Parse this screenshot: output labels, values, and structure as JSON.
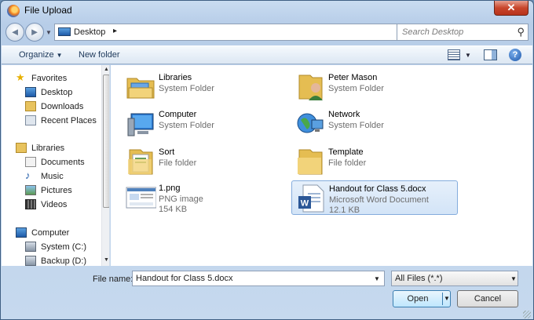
{
  "window": {
    "title": "File Upload",
    "close": "✕"
  },
  "nav": {
    "back": "◄",
    "forward": "►",
    "address": "Desktop",
    "address_chevron": "▸",
    "search_placeholder": "Search Desktop"
  },
  "toolbar": {
    "organize": "Organize",
    "new_folder": "New folder"
  },
  "sidebar": {
    "favorites": "Favorites",
    "desktop": "Desktop",
    "downloads": "Downloads",
    "recent_places": "Recent Places",
    "libraries": "Libraries",
    "documents": "Documents",
    "music": "Music",
    "pictures": "Pictures",
    "videos": "Videos",
    "computer": "Computer",
    "system_c": "System (C:)",
    "backup_d": "Backup (D:)"
  },
  "items": [
    {
      "name": "Libraries",
      "type": "System Folder",
      "icon": "libraries-icon"
    },
    {
      "name": "Peter Mason",
      "type": "System Folder",
      "icon": "user-folder-icon"
    },
    {
      "name": "Computer",
      "type": "System Folder",
      "icon": "computer-icon"
    },
    {
      "name": "Network",
      "type": "System Folder",
      "icon": "network-icon"
    },
    {
      "name": "Sort",
      "type": "File folder",
      "icon": "folder-icon"
    },
    {
      "name": "Template",
      "type": "File folder",
      "icon": "folder-icon"
    },
    {
      "name": "1.png",
      "type": "PNG image",
      "size": "154 KB",
      "icon": "png-thumbnail-icon"
    },
    {
      "name": "Handout for Class 5.docx",
      "type": "Microsoft Word Document",
      "size": "12.1 KB",
      "icon": "word-document-icon",
      "selected": true
    }
  ],
  "footer": {
    "file_name_label": "File name:",
    "file_name_value": "Handout for Class 5.docx",
    "file_type": "All Files (*.*)",
    "open": "Open",
    "cancel": "Cancel"
  },
  "colors": {
    "selection": "#d3e4f7",
    "selection_border": "#84acdd",
    "window_frame": "#b7cde8"
  }
}
